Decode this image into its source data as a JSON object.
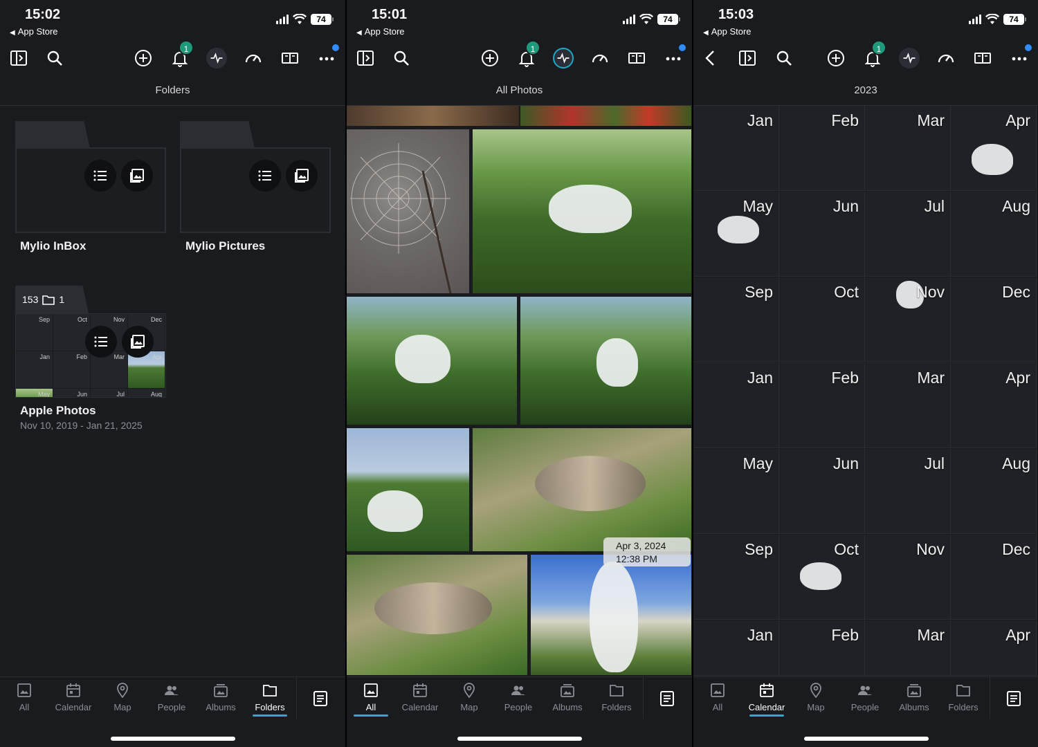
{
  "screens": [
    {
      "time": "15:02",
      "back_app": "App Store",
      "battery": "74",
      "notif_count": "1",
      "view_title": "Folders",
      "folders": [
        {
          "name": "Mylio InBox"
        },
        {
          "name": "Mylio Pictures"
        }
      ],
      "apple": {
        "count": "153",
        "subfolders": "1",
        "name": "Apple Photos",
        "range": "Nov 10, 2019 - Jan 21, 2025",
        "mini_months": [
          "Sep",
          "Oct",
          "Nov",
          "Dec",
          "Jan",
          "Feb",
          "Mar",
          "Apr",
          "May",
          "Jun",
          "Jul",
          "Aug"
        ]
      },
      "active_tab": "Folders"
    },
    {
      "time": "15:01",
      "back_app": "App Store",
      "battery": "74",
      "notif_count": "1",
      "view_title": "All Photos",
      "date_tip": {
        "date": "Apr 3, 2024",
        "time": "12:38 PM"
      },
      "active_tab": "All"
    },
    {
      "time": "15:03",
      "back_app": "App Store",
      "battery": "74",
      "notif_count": "1",
      "view_title": "2023",
      "months": [
        "Jan",
        "Feb",
        "Mar",
        "Apr",
        "May",
        "Jun",
        "Jul",
        "Aug",
        "Sep",
        "Oct",
        "Nov",
        "Dec",
        "Jan",
        "Feb",
        "Mar",
        "Apr",
        "May",
        "Jun",
        "Jul",
        "Aug",
        "Sep",
        "Oct",
        "Nov",
        "Dec",
        "Jan",
        "Feb",
        "Mar",
        "Apr"
      ],
      "active_tab": "Calendar"
    }
  ],
  "tabs": [
    "All",
    "Calendar",
    "Map",
    "People",
    "Albums",
    "Folders"
  ],
  "icons": {
    "toolbar": [
      "sidebar-toggle-icon",
      "search-icon",
      "add-icon",
      "bell-icon",
      "activity-icon",
      "dashboard-icon",
      "book-icon",
      "more-icon"
    ],
    "tabs": [
      "photo-icon",
      "calendar-icon",
      "map-pin-icon",
      "people-icon",
      "albums-icon",
      "folder-icon"
    ],
    "tab_extra": "document-list-icon"
  },
  "colors": {
    "background": "#1a1b1f",
    "accent": "#37a7c7",
    "badge": "#1e9a7b",
    "dot": "#2f8cff"
  }
}
